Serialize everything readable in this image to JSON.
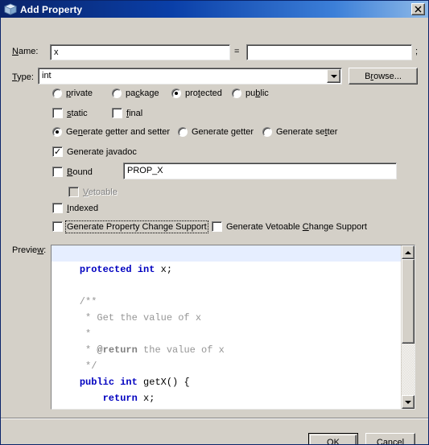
{
  "window": {
    "title": "Add Property",
    "icon": "cube-icon",
    "close_label": "✕"
  },
  "form": {
    "name_label": "Name:",
    "name_mnemonic": "N",
    "name_value": "x",
    "equals_sign": "=",
    "init_value": "",
    "semicolon": ";",
    "type_label": "Type:",
    "type_mnemonic": "T",
    "type_value": "int",
    "browse_label": "Browse...",
    "browse_mnemonic": "r"
  },
  "modifiers": {
    "access": [
      {
        "label": "private",
        "mnemonic": "p",
        "pre": "",
        "post": "rivate",
        "selected": false
      },
      {
        "label": "package",
        "mnemonic": "c",
        "pre": "pa",
        "post": "kage",
        "selected": false
      },
      {
        "label": "protected",
        "mnemonic": "t",
        "pre": "pro",
        "post": "ected",
        "selected": true
      },
      {
        "label": "public",
        "mnemonic": "b",
        "pre": "pu",
        "post": "lic",
        "selected": false
      }
    ],
    "static_label": "static",
    "static_pre": "",
    "static_mn": "s",
    "static_post": "tatic",
    "static_checked": false,
    "final_label": "final",
    "final_pre": "",
    "final_mn": "f",
    "final_post": "inal",
    "final_checked": false
  },
  "accessors": [
    {
      "label": "Generate getter and setter",
      "pre": "Ge",
      "mn": "n",
      "post": "erate getter and setter",
      "selected": true
    },
    {
      "label": "Generate getter",
      "pre": "Generate ",
      "mn": "g",
      "post": "etter",
      "selected": false
    },
    {
      "label": "Generate setter",
      "pre": "Generate se",
      "mn": "t",
      "post": "ter",
      "selected": false
    }
  ],
  "options": {
    "javadoc": {
      "label": "Generate javadoc",
      "pre": "Generate ",
      "mn": "j",
      "post": "avadoc",
      "checked": true,
      "disabled": false
    },
    "bound": {
      "label": "Bound",
      "pre": "",
      "mn": "B",
      "post": "ound",
      "checked": false,
      "disabled": false
    },
    "bound_field_value": "PROP_X",
    "vetoable": {
      "label": "Vetoable",
      "pre": "",
      "mn": "V",
      "post": "etoable",
      "checked": false,
      "disabled": true
    },
    "indexed": {
      "label": "Indexed",
      "pre": "",
      "mn": "I",
      "post": "ndexed",
      "checked": false,
      "disabled": false
    },
    "prop_change": {
      "label": "Generate Property Change Support",
      "pre": "Generate Property Change Support",
      "mn": "",
      "post": "",
      "checked": false,
      "disabled": false,
      "focused": true
    },
    "veto_change": {
      "label": "Generate Vetoable Change Support",
      "pre": "Generate Vetoable ",
      "mn": "C",
      "post": "hange Support",
      "checked": false,
      "disabled": false
    }
  },
  "preview": {
    "label": "Preview:",
    "label_pre": "Previe",
    "label_mn": "w",
    "label_post": ":",
    "scroll_thumb_top_pct": 0,
    "scroll_thumb_height_pct": 62,
    "code_lines": [
      {
        "caret": true,
        "tokens": []
      },
      {
        "caret": false,
        "tokens": [
          {
            "t": "    ",
            "c": "plain"
          },
          {
            "t": "protected",
            "c": "kw"
          },
          {
            "t": " ",
            "c": "plain"
          },
          {
            "t": "int",
            "c": "kw"
          },
          {
            "t": " x;",
            "c": "plain"
          }
        ]
      },
      {
        "caret": false,
        "tokens": []
      },
      {
        "caret": false,
        "tokens": [
          {
            "t": "    /**",
            "c": "cmt"
          }
        ]
      },
      {
        "caret": false,
        "tokens": [
          {
            "t": "     * Get the value of x",
            "c": "cmt"
          }
        ]
      },
      {
        "caret": false,
        "tokens": [
          {
            "t": "     *",
            "c": "cmt"
          }
        ]
      },
      {
        "caret": false,
        "tokens": [
          {
            "t": "     * ",
            "c": "cmt"
          },
          {
            "t": "@return",
            "c": "cmt-b"
          },
          {
            "t": " the value of x",
            "c": "cmt"
          }
        ]
      },
      {
        "caret": false,
        "tokens": [
          {
            "t": "     */",
            "c": "cmt"
          }
        ]
      },
      {
        "caret": false,
        "tokens": [
          {
            "t": "    ",
            "c": "plain"
          },
          {
            "t": "public",
            "c": "kw"
          },
          {
            "t": " ",
            "c": "plain"
          },
          {
            "t": "int",
            "c": "kw"
          },
          {
            "t": " getX() {",
            "c": "plain"
          }
        ]
      },
      {
        "caret": false,
        "tokens": [
          {
            "t": "        ",
            "c": "plain"
          },
          {
            "t": "return",
            "c": "kw"
          },
          {
            "t": " x;",
            "c": "plain"
          }
        ]
      },
      {
        "caret": false,
        "tokens": [
          {
            "t": "    }",
            "c": "plain"
          }
        ]
      }
    ]
  },
  "buttons": {
    "ok": "OK",
    "cancel": "Cancel"
  },
  "colors": {
    "dialog_face": "#d4d0c8",
    "title_start": "#0a246a",
    "title_end": "#8db9e8",
    "keyword": "#0000c0",
    "comment": "#969696",
    "caret_line": "#e6eeff"
  }
}
